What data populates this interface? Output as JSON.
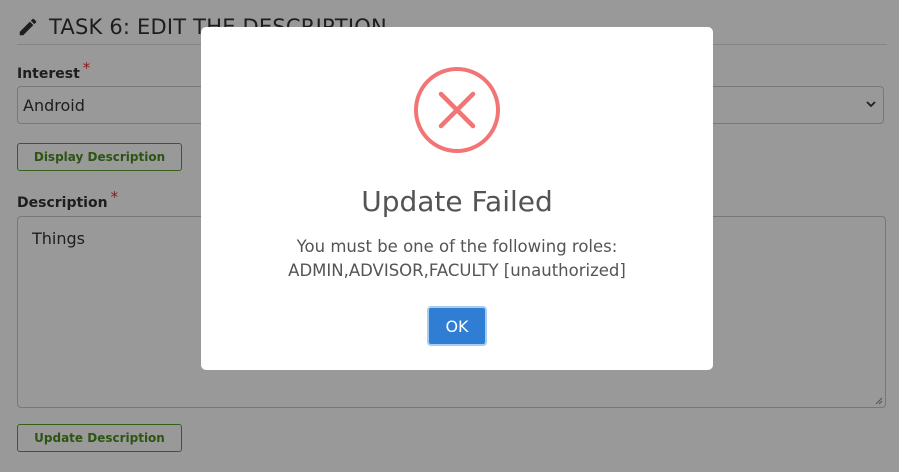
{
  "task": {
    "title": "TASK 6: EDIT THE DESCRIPTION",
    "icon": "pencil-icon"
  },
  "interest": {
    "label": "Interest",
    "required_mark": "*",
    "selected_value": "Android"
  },
  "display_button": {
    "label": "Display Description"
  },
  "description": {
    "label": "Description",
    "required_mark": "*",
    "value": "Things"
  },
  "update_button": {
    "label": "Update Description"
  },
  "modal": {
    "icon": "error-x-icon",
    "title": "Update Failed",
    "message_line1": "You must be one of the following roles:",
    "message_line2": "ADMIN,ADVISOR,FACULTY [unauthorized]",
    "ok_label": "OK"
  },
  "colors": {
    "accent_green": "#5aa02c",
    "error_red": "#f27474",
    "ok_blue": "#2f7ed3"
  }
}
